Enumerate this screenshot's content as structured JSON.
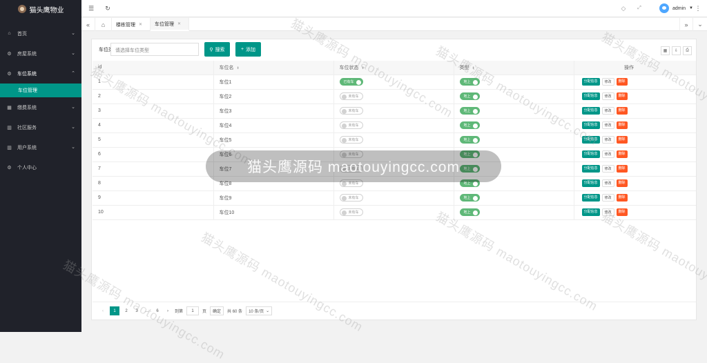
{
  "app_title": "猫头鹰物业",
  "sidebar": {
    "items": [
      {
        "label": "首页",
        "icon": "home-icon"
      },
      {
        "label": "房屋系统",
        "icon": "gear-icon"
      },
      {
        "label": "车位系统",
        "icon": "gear-icon"
      },
      {
        "label": "缴费系统",
        "icon": "grid-icon"
      },
      {
        "label": "社区服务",
        "icon": "building-icon"
      },
      {
        "label": "用户系统",
        "icon": "building-icon"
      },
      {
        "label": "个人中心",
        "icon": "gear-icon"
      }
    ],
    "active_sub": "车位管理"
  },
  "header": {
    "user": "admin"
  },
  "tabs": [
    {
      "label": "楼栋管理",
      "active": false
    },
    {
      "label": "车位管理",
      "active": true
    }
  ],
  "filter": {
    "label": "车位类型:",
    "placeholder": "请选择车位类型",
    "search_label": "搜索",
    "add_label": "添加"
  },
  "table": {
    "columns": [
      "id",
      "车位名",
      "车位状态",
      "类型",
      "操作"
    ],
    "rows": [
      {
        "id": "1",
        "name": "车位1",
        "status": "已有车",
        "type": "地上"
      },
      {
        "id": "2",
        "name": "车位2",
        "status": "未有车",
        "type": "地上"
      },
      {
        "id": "3",
        "name": "车位3",
        "status": "未有车",
        "type": "地上"
      },
      {
        "id": "4",
        "name": "车位4",
        "status": "未有车",
        "type": "地上"
      },
      {
        "id": "5",
        "name": "车位5",
        "status": "未有车",
        "type": "地上"
      },
      {
        "id": "6",
        "name": "车位6",
        "status": "未有车",
        "type": "地上"
      },
      {
        "id": "7",
        "name": "车位7",
        "status": "未有车",
        "type": "地上"
      },
      {
        "id": "8",
        "name": "车位8",
        "status": "未有车",
        "type": "地上"
      },
      {
        "id": "9",
        "name": "车位9",
        "status": "未有车",
        "type": "地上"
      },
      {
        "id": "10",
        "name": "车位10",
        "status": "未有车",
        "type": "地上"
      }
    ],
    "ops": {
      "assign": "分配信息",
      "edit": "修改",
      "delete": "删除"
    }
  },
  "pagination": {
    "pages": [
      "1",
      "2",
      "3",
      "…",
      "6"
    ],
    "goto_label": "到第",
    "page_value": "1",
    "page_unit": "页",
    "confirm": "确定",
    "total": "共 60 条",
    "page_size": "10 条/页"
  },
  "watermark": {
    "text": "猫头鹰源码 maotouyingcc.com"
  },
  "colors": {
    "accent": "#009688",
    "danger": "#ff5722",
    "switch_on": "#5fb878",
    "sidebar": "#20222a"
  }
}
